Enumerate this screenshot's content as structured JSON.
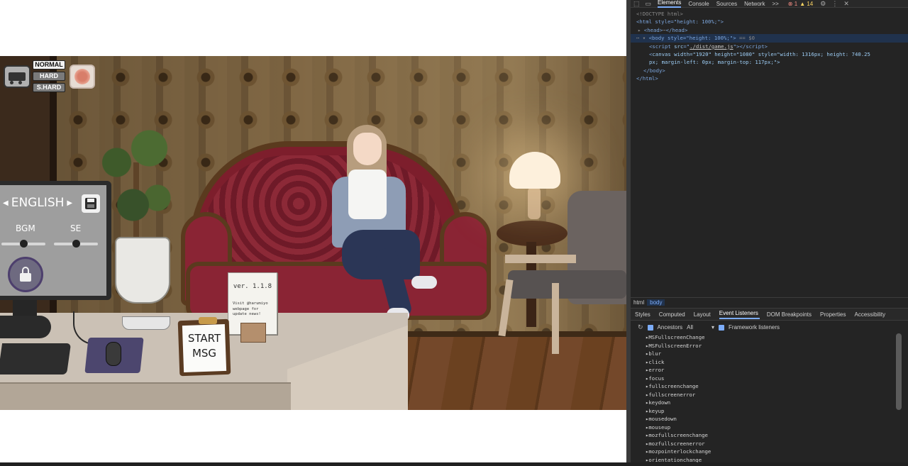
{
  "game": {
    "difficulty": {
      "normal": "NORMAL",
      "hard": "HARD",
      "super_hard": "S.HARD"
    },
    "settings": {
      "language": "ENGLISH",
      "bgm_label": "BGM",
      "se_label": "SE",
      "bgm_level": 0.5,
      "se_level": 0.5
    },
    "version_sign": {
      "version": "ver. 1.1.8",
      "note": "Visit @harumiyo webpage for update news!"
    },
    "clipboard": {
      "line1": "START",
      "line2": "MSG"
    }
  },
  "devtools": {
    "tabs": [
      "Elements",
      "Console",
      "Sources",
      "Network",
      ">>"
    ],
    "active_tab": "Elements",
    "error_count": "1",
    "warning_count": "14",
    "code": {
      "doctype": "<!DOCTYPE html>",
      "html_open": "html style=\"height: 100%;\"",
      "head": "head",
      "body_open": "body style=\"height: 100%;\"",
      "body_suffix": "== $0",
      "script_src": "./dist/game.js",
      "canvas_attrs": "canvas width=\"1920\" height=\"1080\" style=\"width: 1316px; height: 740.25",
      "canvas_attrs_cont": "px; margin-left: 0px; margin-top: 117px;\">",
      "body_close": "</body>",
      "html_close": "</html>"
    },
    "breadcrumbs": [
      "html",
      "body"
    ],
    "subtabs": [
      "Styles",
      "Computed",
      "Layout",
      "Event Listeners",
      "DOM Breakpoints",
      "Properties",
      "Accessibility"
    ],
    "active_subtab": "Event Listeners",
    "filter": {
      "ancestors_label": "Ancestors",
      "ancestors_value": "All",
      "framework_label": "Framework listeners"
    },
    "events": [
      "MSFullscreenChange",
      "MSFullscreenError",
      "blur",
      "click",
      "error",
      "focus",
      "fullscreenchange",
      "fullscreenerror",
      "keydown",
      "keyup",
      "mousedown",
      "mouseup",
      "mozfullscreenchange",
      "mozfullscreenerror",
      "mozpointerlockchange",
      "orientationchange"
    ]
  }
}
